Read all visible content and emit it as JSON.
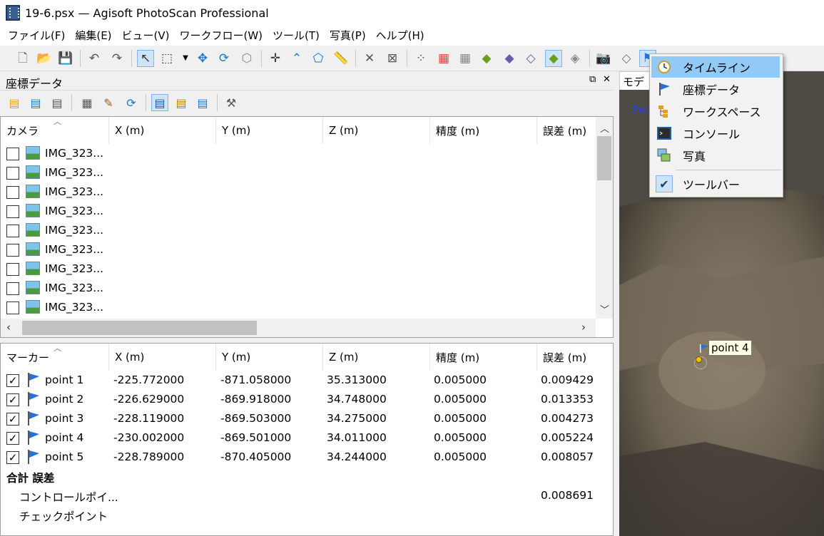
{
  "window": {
    "title": "19-6.psx — Agisoft PhotoScan Professional"
  },
  "menu": [
    "ファイル(F)",
    "編集(E)",
    "ビュー(V)",
    "ワークフロー(W)",
    "ツール(T)",
    "写真(P)",
    "ヘルプ(H)"
  ],
  "panel": {
    "title": "座標データ"
  },
  "camera_table": {
    "columns": [
      "カメラ",
      "X (m)",
      "Y (m)",
      "Z (m)",
      "精度 (m)",
      "誤差 (m)"
    ],
    "rows": [
      "IMG_323...",
      "IMG_323...",
      "IMG_323...",
      "IMG_323...",
      "IMG_323...",
      "IMG_323...",
      "IMG_323...",
      "IMG_323...",
      "IMG_323..."
    ]
  },
  "marker_table": {
    "columns": [
      "マーカー",
      "X (m)",
      "Y (m)",
      "Z (m)",
      "精度 (m)",
      "誤差 (m)"
    ],
    "rows": [
      {
        "name": "point 1",
        "x": "-225.772000",
        "y": "-871.058000",
        "z": "35.313000",
        "acc": "0.005000",
        "err": "0.009429"
      },
      {
        "name": "point 2",
        "x": "-226.629000",
        "y": "-869.918000",
        "z": "34.748000",
        "acc": "0.005000",
        "err": "0.013353"
      },
      {
        "name": "point 3",
        "x": "-228.119000",
        "y": "-869.503000",
        "z": "34.275000",
        "acc": "0.005000",
        "err": "0.004273"
      },
      {
        "name": "point 4",
        "x": "-230.002000",
        "y": "-869.501000",
        "z": "34.011000",
        "acc": "0.005000",
        "err": "0.005224"
      },
      {
        "name": "point 5",
        "x": "-228.789000",
        "y": "-870.405000",
        "z": "34.244000",
        "acc": "0.005000",
        "err": "0.008057"
      }
    ],
    "total_label": "合計 誤差",
    "control_label": "コントロールポイ...",
    "control_err": "0.008691",
    "check_label": "チェックポイント",
    "check_mark": "✓"
  },
  "viewport": {
    "tab": "モデ",
    "persp": "Per",
    "marker_label": "point 4"
  },
  "dropdown": {
    "items": [
      {
        "label": "タイムライン",
        "icon": "clock-icon"
      },
      {
        "label": "座標データ",
        "icon": "flag-icon"
      },
      {
        "label": "ワークスペース",
        "icon": "workspace-icon"
      },
      {
        "label": "コンソール",
        "icon": "console-icon"
      },
      {
        "label": "写真",
        "icon": "photos-icon"
      },
      {
        "label": "ツールバー",
        "icon": "check-icon"
      }
    ]
  },
  "colors": {
    "highlight": "#91c9f7",
    "toolbar_selected": "#cde4f7",
    "flag_blue": "#2a6fd1"
  }
}
